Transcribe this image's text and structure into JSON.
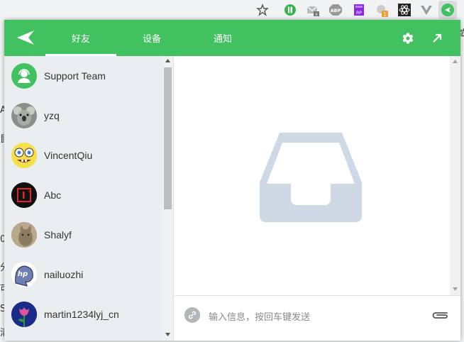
{
  "header": {
    "tabs": [
      {
        "label": "好友",
        "active": true
      },
      {
        "label": "设备",
        "active": false
      },
      {
        "label": "通知",
        "active": false
      }
    ],
    "accent_color": "#41c15f"
  },
  "contacts": [
    {
      "name": "Support Team",
      "avatar": "support-avatar"
    },
    {
      "name": "yzq",
      "avatar": "koala-avatar"
    },
    {
      "name": "VincentQiu",
      "avatar": "sponge-avatar"
    },
    {
      "name": "Abc",
      "avatar": "oneplus-avatar"
    },
    {
      "name": "Shalyf",
      "avatar": "cat-avatar"
    },
    {
      "name": "nailuozhi",
      "avatar": "php-avatar"
    },
    {
      "name": "martin1234lyj_cn",
      "avatar": "tulip-avatar"
    }
  ],
  "composer": {
    "placeholder": "输入信息，按回车键发送"
  },
  "empty_state": {
    "icon": "inbox-icon"
  }
}
